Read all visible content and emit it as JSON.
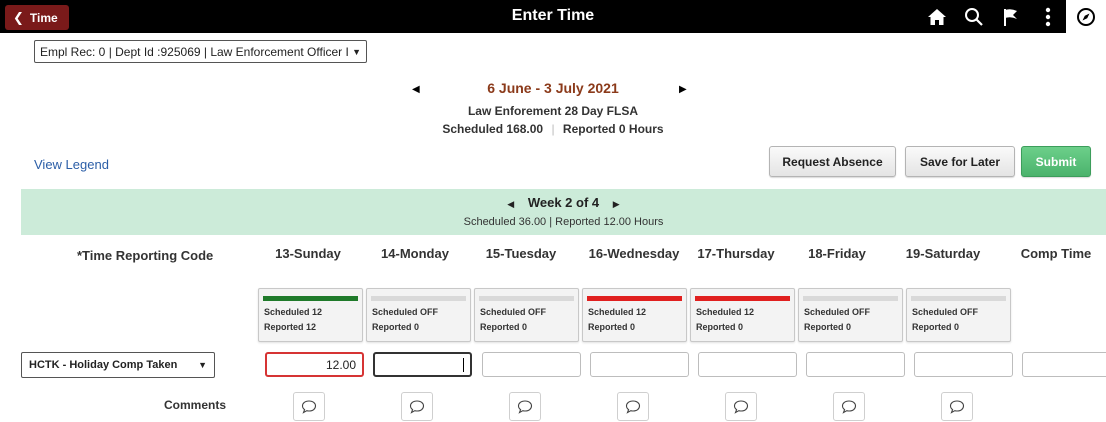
{
  "header": {
    "back_label": "Time",
    "title": "Enter Time",
    "icons": [
      "home-icon",
      "search-icon",
      "flag-icon",
      "more-icon",
      "navigator-icon"
    ]
  },
  "employee_select": {
    "value": "Empl Rec: 0 | Dept Id :925069 | Law Enforcement Officer I"
  },
  "period": {
    "range": "6 June - 3 July 2021",
    "schedule_name": "Law Enforement 28 Day FLSA",
    "scheduled_label": "Scheduled",
    "scheduled_value": "168.00",
    "reported_text": "Reported  0 Hours"
  },
  "view_legend": "View Legend",
  "actions": {
    "request_absence": "Request Absence",
    "save_for_later": "Save for Later",
    "submit": "Submit"
  },
  "week": {
    "title": "Week 2 of 4",
    "hours": "Scheduled 36.00 | Reported 12.00 Hours"
  },
  "grid": {
    "trc_header": "*Time Reporting Code",
    "days": [
      "13-Sunday",
      "14-Monday",
      "15-Tuesday",
      "16-Wednesday",
      "17-Thursday",
      "18-Friday",
      "19-Saturday"
    ],
    "comp_time_header": "Comp Time",
    "schedules": [
      {
        "scheduled": "Scheduled 12",
        "reported": "Reported  12",
        "bar": "#1f7a2a"
      },
      {
        "scheduled": "Scheduled OFF",
        "reported": "Reported  0",
        "bar": "#d9d9d9"
      },
      {
        "scheduled": "Scheduled OFF",
        "reported": "Reported  0",
        "bar": "#d9d9d9"
      },
      {
        "scheduled": "Scheduled 12",
        "reported": "Reported  0",
        "bar": "#e0201f"
      },
      {
        "scheduled": "Scheduled 12",
        "reported": "Reported  0",
        "bar": "#e0201f"
      },
      {
        "scheduled": "Scheduled OFF",
        "reported": "Reported  0",
        "bar": "#d9d9d9"
      },
      {
        "scheduled": "Scheduled OFF",
        "reported": "Reported  0",
        "bar": "#d9d9d9"
      }
    ],
    "row": {
      "trc_value": "HCTK - Holiday Comp Taken",
      "hours": [
        "12.00",
        "",
        "",
        "",
        "",
        "",
        "",
        ""
      ]
    },
    "comments_label": "Comments"
  },
  "colors": {
    "header_bg": "#000000",
    "back_button": "#7a1a1a",
    "period_title": "#8b3a1a",
    "week_band": "#ccebd9",
    "submit": "#4bb36c",
    "link": "#2b5ea7"
  }
}
